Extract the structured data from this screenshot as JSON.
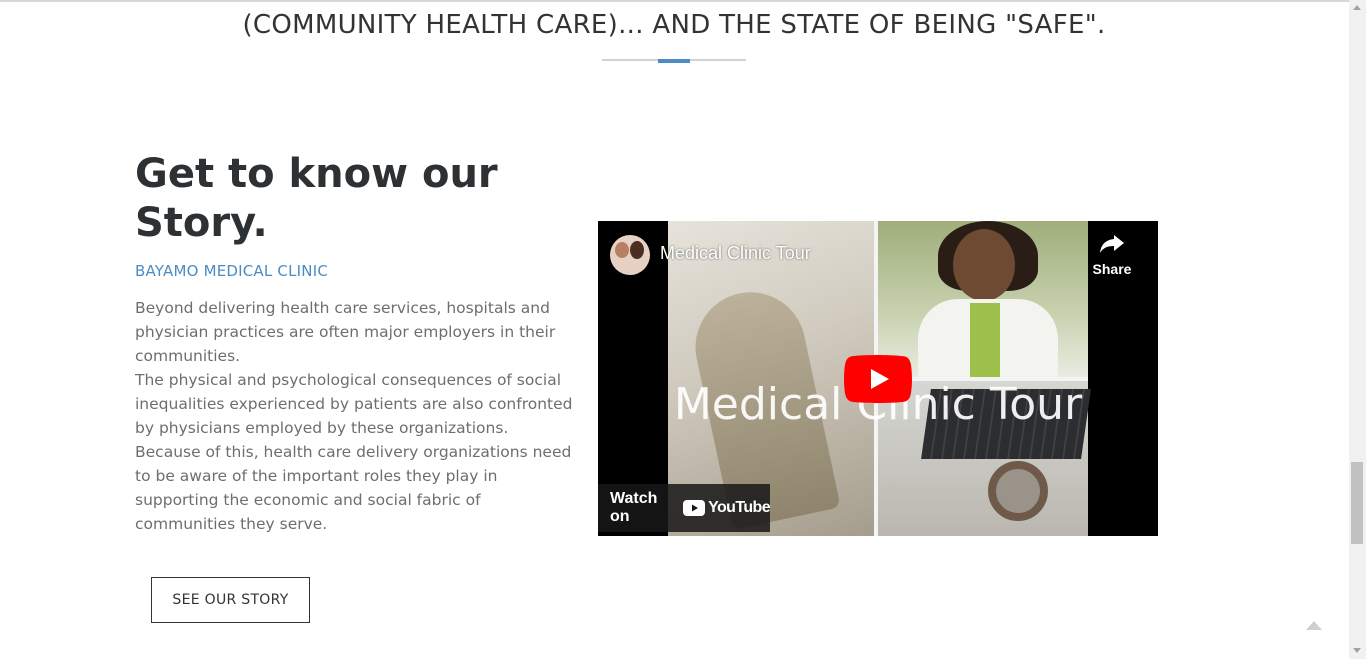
{
  "tagline": "(COMMUNITY HEALTH CARE)... AND THE STATE OF BEING \"SAFE\".",
  "story": {
    "heading": "Get to know our Story.",
    "subtitle": "BAYAMO MEDICAL CLINIC",
    "paragraph_1": "Beyond delivering health care services, hospitals and physician practices are often major employers in their communities.",
    "paragraph_2": "The physical and psychological consequences of social inequalities experienced by patients are also confronted by physicians employed by these organizations. Because of this, health care delivery organizations need to be aware of the important roles they play in supporting the economic and social fabric of communities they serve.",
    "button_label": "SEE OUR STORY"
  },
  "video": {
    "title": "Medical Clinic Tour",
    "thumbnail_text": "Medical Clinic Tour",
    "share_label": "Share",
    "watch_on_label": "Watch on",
    "youtube_label": "YouTube",
    "play_color": "#ff0000"
  },
  "colors": {
    "accent": "#4c8cc4",
    "heading": "#2e3133",
    "body_text": "#6b6f72"
  },
  "icons": {
    "back_to_top": "chevron-up-icon",
    "share": "share-arrow-icon",
    "play": "play-icon"
  }
}
